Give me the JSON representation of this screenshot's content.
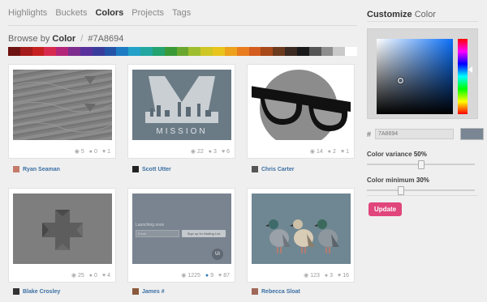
{
  "nav": {
    "tabs": [
      {
        "label": "Highlights",
        "active": false
      },
      {
        "label": "Buckets",
        "active": false
      },
      {
        "label": "Colors",
        "active": true
      },
      {
        "label": "Projects",
        "active": false
      },
      {
        "label": "Tags",
        "active": false
      }
    ]
  },
  "browse": {
    "prefix": "Browse by",
    "bold": "Color",
    "separator": "/",
    "hex": "#7A8694"
  },
  "swatches": [
    "#6e1111",
    "#a51a1a",
    "#c72020",
    "#d82a4f",
    "#b3267a",
    "#7d2e8e",
    "#58319c",
    "#3a3c9c",
    "#2454a8",
    "#1c7bc2",
    "#23a1c9",
    "#22a7a0",
    "#23a36f",
    "#3a9a37",
    "#6aa72f",
    "#9fbe2f",
    "#cfc624",
    "#e8c41d",
    "#eda11c",
    "#e87c1f",
    "#d45c1f",
    "#a8491a",
    "#6c3a1d",
    "#3a2a22",
    "#1a1a1a",
    "#555555",
    "#8e8e8e",
    "#c9c9c9",
    "#ffffff"
  ],
  "cards": [
    {
      "views": "5",
      "comments": "0",
      "likes": "1",
      "author": "Ryan Seaman",
      "comment_highlight": false
    },
    {
      "views": "22",
      "comments": "3",
      "likes": "6",
      "author": "Scott Utter",
      "comment_highlight": false,
      "caption": "MISSION"
    },
    {
      "views": "14",
      "comments": "2",
      "likes": "1",
      "author": "Chris Carter",
      "comment_highlight": false
    },
    {
      "views": "25",
      "comments": "0",
      "likes": "4",
      "author": "Blake Crosley",
      "comment_highlight": false
    },
    {
      "views": "1225",
      "comments": "9",
      "likes": "87",
      "author": "James #",
      "comment_highlight": true,
      "text_launch": "Launching soon",
      "text_button": "Sign up for Mailing List",
      "text_input": "Email"
    },
    {
      "views": "123",
      "comments": "3",
      "likes": "16",
      "author": "Rebecca Sloat",
      "comment_highlight": false
    }
  ],
  "panel": {
    "title_bold": "Customize",
    "title_light": "Color",
    "hash": "#",
    "hex_value": "7A8694",
    "chip_color": "#7A8694",
    "variance_label": "Color variance",
    "variance_value": "50%",
    "variance_level": 0.5,
    "minimum_label": "Color minimum",
    "minimum_value": "30%",
    "minimum_level": 0.3,
    "update_label": "Update"
  },
  "colors": {
    "accent": "#e0457b",
    "link": "#3c70a4",
    "selected": "#7A8694"
  }
}
